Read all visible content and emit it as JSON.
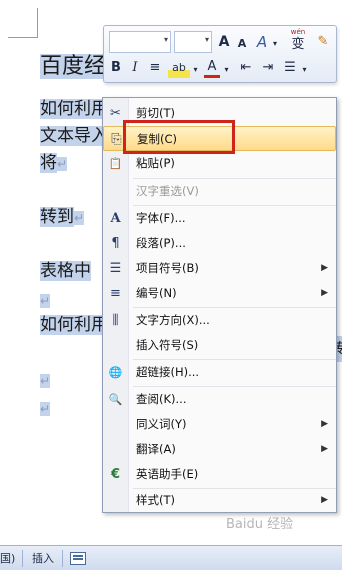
{
  "document": {
    "title": "百度经",
    "lines": [
      "如何利用",
      "文本导入",
      "将",
      "转到",
      "表格中",
      "如何利用"
    ],
    "para_mark": "↵",
    "right_glyph": "转"
  },
  "mini_toolbar": {
    "bold": "B",
    "italic": "I",
    "align": "≡",
    "highlight": "ab",
    "font_color": "A",
    "grow_font": "A",
    "shrink_font": "A",
    "styles": "A",
    "phonetic_top": "wén",
    "phonetic_bottom": "变",
    "brush": "✎",
    "indent_dec": "⇤",
    "indent_inc": "⇥",
    "bullets": "☰",
    "dropdown": "▾"
  },
  "context_menu": {
    "items": [
      {
        "label": "剪切(T)",
        "icon": "scissors-icon",
        "glyph": "✂"
      },
      {
        "label": "复制(C)",
        "icon": "copy-icon",
        "glyph": "⎘",
        "highlighted": true
      },
      {
        "label": "粘贴(P)",
        "icon": "paste-icon",
        "glyph": "📋"
      },
      {
        "label": "汉字重选(V)",
        "disabled": true
      },
      {
        "label": "字体(F)...",
        "icon": "font-icon",
        "glyph": "A"
      },
      {
        "label": "段落(P)...",
        "icon": "paragraph-icon",
        "glyph": "¶"
      },
      {
        "label": "项目符号(B)",
        "icon": "bullets-icon",
        "glyph": "☰",
        "submenu": true
      },
      {
        "label": "编号(N)",
        "icon": "numbering-icon",
        "glyph": "≡",
        "submenu": true
      },
      {
        "label": "文字方向(X)...",
        "icon": "text-direction-icon",
        "glyph": "⫼"
      },
      {
        "label": "插入符号(S)"
      },
      {
        "label": "超链接(H)...",
        "icon": "hyperlink-icon",
        "glyph": "🌐"
      },
      {
        "label": "查阅(K)...",
        "icon": "lookup-icon",
        "glyph": "🔍"
      },
      {
        "label": "同义词(Y)",
        "submenu": true
      },
      {
        "label": "翻译(A)",
        "submenu": true
      },
      {
        "label": "英语助手(E)",
        "icon": "english-assistant-icon",
        "glyph": "€"
      },
      {
        "label": "样式(T)",
        "submenu": true
      }
    ],
    "submenu_arrow": "▶"
  },
  "status_bar": {
    "left_text": "国)",
    "insert_label": "插入"
  },
  "watermark": "Baidu 经验"
}
